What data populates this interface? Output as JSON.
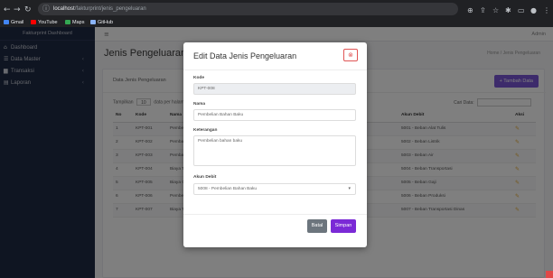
{
  "browser": {
    "url_host": "localhost",
    "url_path": "/fakturprint/jenis_pengeluaran",
    "bookmarks": [
      {
        "label": "Gmail",
        "color": "#4285f4"
      },
      {
        "label": "YouTube",
        "color": "#ff0000"
      },
      {
        "label": "Maps",
        "color": "#34a853"
      },
      {
        "label": "GitHub",
        "color": "#8ab4f8"
      }
    ]
  },
  "sidebar": {
    "brand": "Fakturprint Dashboard",
    "items": [
      {
        "label": "Dashboard",
        "icon": "dashboard-icon"
      },
      {
        "label": "Data Master",
        "icon": "list-icon"
      },
      {
        "label": "Transaksi",
        "icon": "cart-icon"
      },
      {
        "label": "Laporan",
        "icon": "report-icon"
      }
    ]
  },
  "main": {
    "user": "Admin",
    "page_title": "Jenis Pengeluaran",
    "breadcrumb": "Home / Jenis Pengeluaran",
    "card_title": "Data Jenis Pengeluaran",
    "add_button": "+ Tambah Data",
    "show_label": "Tampilkan",
    "show_value": "10",
    "show_suffix": "data per halaman",
    "search_label": "Cari Data:",
    "table": {
      "headers": [
        "No",
        "Kode",
        "Nama",
        "Keterangan",
        "Akun Debit",
        "Aksi"
      ],
      "rows": [
        [
          "1",
          "KPT-001",
          "Pembelian ATK",
          "Pembelian alat tulis kantor",
          "5001 - Beban Alat Tulis",
          "edit"
        ],
        [
          "2",
          "KPT-002",
          "Pembayaran Listrik",
          "Pembayaran listrik bulanan",
          "5002 - Beban Listrik",
          "edit"
        ],
        [
          "3",
          "KPT-003",
          "Pembayaran Air",
          "Pembayaran air bulanan",
          "5003 - Beban Air",
          "edit"
        ],
        [
          "4",
          "KPT-004",
          "Biaya Transportasi",
          "Biaya transportasi operasional",
          "5004 - Beban Transportasi",
          "edit"
        ],
        [
          "5",
          "KPT-005",
          "Biaya Gaji",
          "Pembayaran gaji karyawan",
          "5005 - Beban Gaji",
          "edit"
        ],
        [
          "6",
          "KPT-006",
          "Pembelian Barang",
          "Pembelian barang dagangan",
          "5006 - Beban Produksi",
          "edit"
        ],
        [
          "7",
          "KPT-007",
          "Biaya Transportasi dan Perjalanan",
          "Biaya Transportasi dan Perjalanan",
          "5007 - Beban Transportasi Dinas",
          "edit"
        ]
      ]
    }
  },
  "modal": {
    "title": "Edit Data Jenis Pengeluaran",
    "kode_label": "Kode",
    "kode_value": "KPT-008",
    "nama_label": "Nama",
    "nama_value": "Pembelian Bahan Baku",
    "keterangan_label": "Keterangan",
    "keterangan_value": "Pembelian bahan baku",
    "akun_label": "Akun Debit",
    "akun_value": "5008 - Pembelian Bahan Baku",
    "cancel_button": "Batal",
    "save_button": "Simpan"
  }
}
